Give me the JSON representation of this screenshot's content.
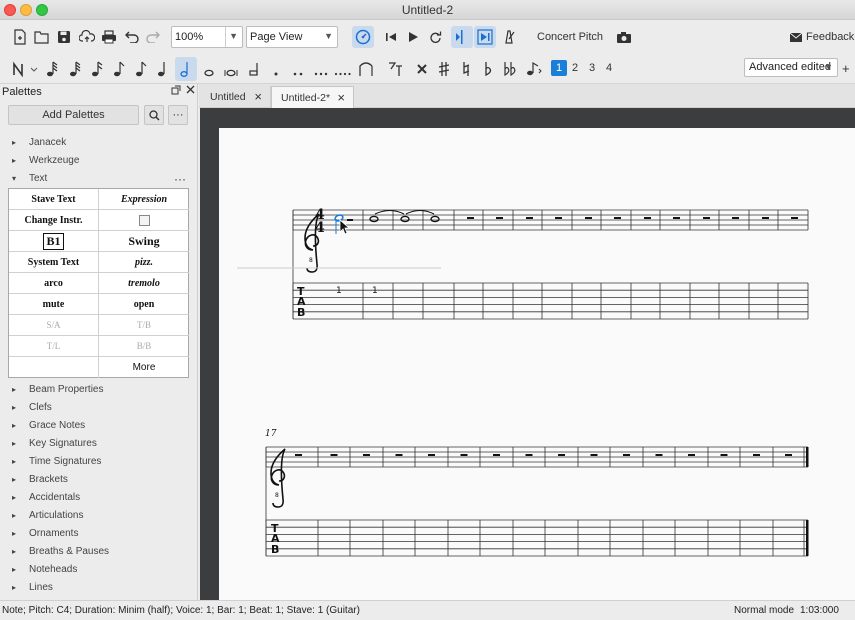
{
  "window": {
    "title": "Untitled-2"
  },
  "toolbar": {
    "zoom_value": "100%",
    "view_mode": "Page View",
    "concert_pitch_label": "Concert Pitch",
    "feedback_label": "Feedback",
    "workspace_value": "Advanced edited",
    "voices": [
      "1",
      "2",
      "3",
      "4"
    ],
    "active_voice": "1"
  },
  "palettes": {
    "header": "Palettes",
    "add_button_label": "Add Palettes",
    "items_top": [
      "Janacek",
      "Werkzeuge"
    ],
    "expanded_item": "Text",
    "text_grid": [
      [
        "Stave Text",
        "Expression"
      ],
      [
        "Change Instr.",
        ""
      ],
      [
        "B1",
        "Swing"
      ],
      [
        "System Text",
        "pizz."
      ],
      [
        "arco",
        "tremolo"
      ],
      [
        "mute",
        "open"
      ],
      [
        "S/A",
        "T/B"
      ],
      [
        "T/L",
        "B/B"
      ],
      [
        "",
        "More"
      ]
    ],
    "items_bottom": [
      "Beam Properties",
      "Clefs",
      "Grace Notes",
      "Key Signatures",
      "Time Signatures",
      "Brackets",
      "Accidentals",
      "Articulations",
      "Ornaments",
      "Breaths & Pauses",
      "Noteheads",
      "Lines"
    ]
  },
  "tabs": [
    {
      "label": "Untitled",
      "active": false
    },
    {
      "label": "Untitled-2*",
      "active": true
    }
  ],
  "score": {
    "system1": {
      "time_sig_top": "4",
      "time_sig_bottom": "4",
      "tab_label": [
        "T",
        "A",
        "B"
      ],
      "fret_numbers": [
        "1",
        "1"
      ]
    },
    "system2": {
      "measure_number": "17",
      "tab_label": [
        "T",
        "A",
        "B"
      ]
    }
  },
  "status": {
    "left": "Note; Pitch: C4; Duration: Minim (half); Voice: 1;  Bar: 1; Beat: 1; Stave: 1 (Guitar)",
    "mode": "Normal mode",
    "time": "1:03:000"
  },
  "colors": {
    "accent": "#1a7fd8",
    "selection": "#1a7fd8",
    "score_bg": "#3c3d3f",
    "page": "#fafafa"
  }
}
